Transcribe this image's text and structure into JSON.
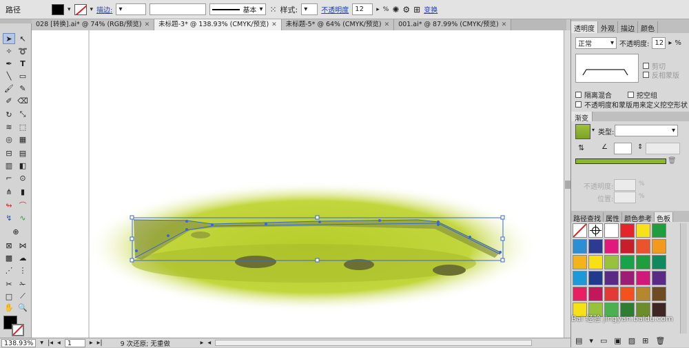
{
  "control_bar": {
    "object_type": "路径",
    "stroke_label": "描边:",
    "profile_label": "基本",
    "style_label": "样式:",
    "opacity_label": "不透明度",
    "opacity_value": "12",
    "opacity_unit": "%",
    "transform_label": "变换"
  },
  "tabs": [
    {
      "label": "028 [转换].ai* @ 74% (RGB/预览)"
    },
    {
      "label": "未标题-3* @ 138.93% (CMYK/预览)"
    },
    {
      "label": "未标题-5* @ 64% (CMYK/预览)"
    },
    {
      "label": "001.ai* @ 87.99% (CMYK/预览)"
    }
  ],
  "status": {
    "zoom": "138.93%",
    "page": "1",
    "undo": "9 次还原; 无重做"
  },
  "transparency_panel": {
    "tabs": [
      "透明度",
      "外观",
      "描边",
      "颜色"
    ],
    "mode": "正常",
    "opacity_label": "不透明度:",
    "opacity_value": "12",
    "opacity_unit": "%",
    "clip": "剪切",
    "invert": "反相蒙版",
    "isolate": "隔离混合",
    "knockout": "挖空组",
    "define": "不透明度和蒙版用来定义挖空形状"
  },
  "gradient_panel": {
    "title": "渐变",
    "type_label": "类型:",
    "opacity_label": "不透明度:",
    "location_label": "位置:",
    "unit": "%"
  },
  "swatches_panel": {
    "tabs": [
      "路径查找",
      "属性",
      "颜色参考",
      "色板"
    ],
    "colors": [
      "#ffffff",
      "#ffffff",
      "#ffffff",
      "#e5242b",
      "#f7e11b",
      "#1e9e3c",
      "#2b8fd8",
      "#2c3b8f",
      "#e0197d",
      "#c71e2a",
      "#e9542d",
      "#f39a1e",
      "#f5b31a",
      "#f6e016",
      "#98c23c",
      "#17a34a",
      "#1e9e3c",
      "#0f8a5f",
      "#1a9bd7",
      "#203a8c",
      "#5b2a85",
      "#9b1e74",
      "#d0197a",
      "#5b2a85",
      "#e91e63",
      "#c2185b",
      "#e53935",
      "#f4511e",
      "#b5882d",
      "#6d4c24",
      "#f6e016",
      "#98c23c",
      "#4caf50",
      "#2e7d32",
      "#6d8c2a",
      "#3e2723"
    ]
  },
  "watermark": "Bai 经验 jingyan.baidu.com",
  "accent": "#3a66d6",
  "grass": "#b8d12e"
}
